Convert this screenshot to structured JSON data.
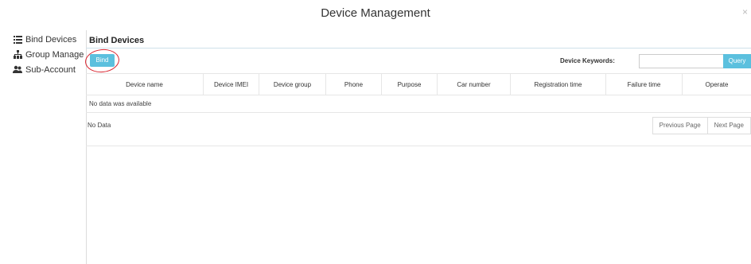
{
  "modal": {
    "title": "Device Management",
    "close_glyph": "×"
  },
  "sidebar": {
    "items": [
      {
        "label": "Bind Devices",
        "icon": "list-icon"
      },
      {
        "label": "Group Manage",
        "icon": "sitemap-icon"
      },
      {
        "label": "Sub-Account",
        "icon": "users-icon"
      }
    ]
  },
  "main": {
    "section_title": "Bind Devices",
    "bind_label": "Bind",
    "keywords_label": "Device Keywords:",
    "keywords_value": "",
    "keywords_placeholder": "",
    "query_label": "Query",
    "columns": [
      "Device name",
      "Device IMEI",
      "Device group",
      "Phone",
      "Purpose",
      "Car number",
      "Registration time",
      "Failure time",
      "Operate"
    ],
    "empty_message": "No data was available",
    "no_data_label": "No Data",
    "prev_page_label": "Previous Page",
    "next_page_label": "Next Page"
  },
  "colors": {
    "accent": "#5bc0de",
    "annotation_circle": "#d9242f"
  }
}
